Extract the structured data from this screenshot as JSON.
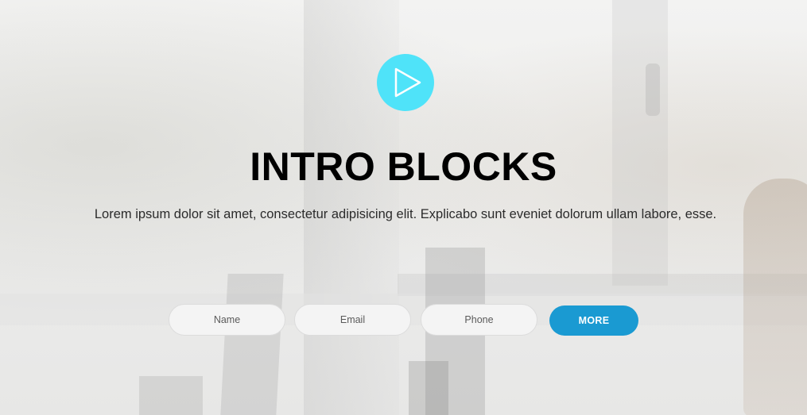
{
  "hero": {
    "title": "INTRO BLOCKS",
    "subtitle": "Lorem ipsum dolor sit amet, consectetur adipisicing elit. Explicabo sunt eveniet dolorum ullam labore, esse.",
    "play_icon": "play-icon",
    "accent_color": "#4fe3f9"
  },
  "form": {
    "name_placeholder": "Name",
    "email_placeholder": "Email",
    "phone_placeholder": "Phone",
    "submit_label": "MORE",
    "submit_color": "#1a9ad2"
  }
}
